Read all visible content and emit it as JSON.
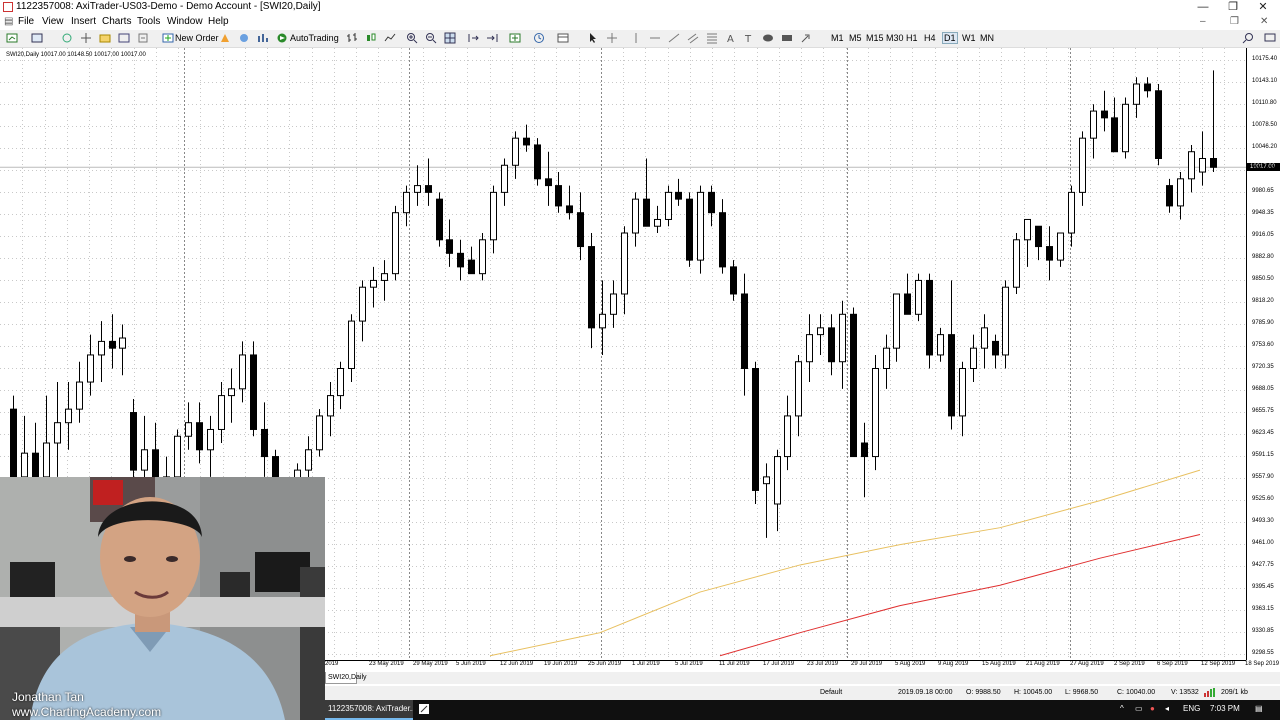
{
  "window": {
    "title": "1122357008: AxiTrader-US03-Demo - Demo Account - [SWI20,Daily]",
    "minimize": "—",
    "restore": "❐",
    "close": "✕"
  },
  "menu": {
    "items": [
      "File",
      "View",
      "Insert",
      "Charts",
      "Tools",
      "Window",
      "Help"
    ]
  },
  "toolbar": {
    "new_order_label": "New Order",
    "autotrading_label": "AutoTrading",
    "timeframes": [
      "M1",
      "M5",
      "M15",
      "M30",
      "H1",
      "H4",
      "D1",
      "W1",
      "MN"
    ],
    "active_timeframe": "D1"
  },
  "chart": {
    "symbol_info": "SWI20,Daily  10017.00 10148.50 10017.00 10017.00",
    "current_price": "10017.00",
    "price_scale": [
      "10175.40",
      "10143.10",
      "10110.80",
      "10078.50",
      "10046.20",
      "10013.90",
      "9980.65",
      "9948.35",
      "9916.05",
      "9882.80",
      "9850.50",
      "9818.20",
      "9785.90",
      "9753.60",
      "9720.35",
      "9688.05",
      "9655.75",
      "9623.45",
      "9591.15",
      "9557.90",
      "9525.60",
      "9493.30",
      "9461.00",
      "9427.75",
      "9395.45",
      "9363.15",
      "9330.85",
      "9298.55"
    ],
    "time_scale": [
      "2019",
      "23 May 2019",
      "29 May 2019",
      "5 Jun 2019",
      "12 Jun 2019",
      "19 Jun 2019",
      "25 Jun 2019",
      "1 Jul 2019",
      "5 Jul 2019",
      "11 Jul 2019",
      "17 Jul 2019",
      "23 Jul 2019",
      "29 Jul 2019",
      "5 Aug 2019",
      "9 Aug 2019",
      "15 Aug 2019",
      "21 Aug 2019",
      "27 Aug 2019",
      "2 Sep 2019",
      "6 Sep 2019",
      "12 Sep 2019",
      "18 Sep 2019"
    ],
    "tab_label": "SWI20,Daily",
    "bull_color": "#ffffff",
    "bear_color": "#000000",
    "ma_slow_color": "#e8c060",
    "ma_fast_color": "#e03030"
  },
  "chart_data": {
    "type": "candlestick",
    "title": "SWI20,Daily",
    "ylim": [
      9298.55,
      10175.4
    ],
    "candles": [
      {
        "o": 9660,
        "h": 9680,
        "l": 9520,
        "c": 9545
      },
      {
        "o": 9560,
        "h": 9650,
        "l": 9530,
        "c": 9595
      },
      {
        "o": 9595,
        "h": 9640,
        "l": 9520,
        "c": 9560
      },
      {
        "o": 9560,
        "h": 9680,
        "l": 9540,
        "c": 9610
      },
      {
        "o": 9610,
        "h": 9700,
        "l": 9560,
        "c": 9640
      },
      {
        "o": 9640,
        "h": 9700,
        "l": 9600,
        "c": 9660
      },
      {
        "o": 9660,
        "h": 9730,
        "l": 9640,
        "c": 9700
      },
      {
        "o": 9700,
        "h": 9770,
        "l": 9680,
        "c": 9740
      },
      {
        "o": 9740,
        "h": 9790,
        "l": 9700,
        "c": 9760
      },
      {
        "o": 9760,
        "h": 9800,
        "l": 9720,
        "c": 9750
      },
      {
        "o": 9750,
        "h": 9785,
        "l": 9710,
        "c": 9765
      },
      {
        "o": 9655,
        "h": 9675,
        "l": 9550,
        "c": 9570
      },
      {
        "o": 9570,
        "h": 9650,
        "l": 9530,
        "c": 9600
      },
      {
        "o": 9600,
        "h": 9640,
        "l": 9510,
        "c": 9530
      },
      {
        "o": 9530,
        "h": 9590,
        "l": 9500,
        "c": 9560
      },
      {
        "o": 9560,
        "h": 9630,
        "l": 9540,
        "c": 9620
      },
      {
        "o": 9620,
        "h": 9670,
        "l": 9600,
        "c": 9640
      },
      {
        "o": 9640,
        "h": 9670,
        "l": 9580,
        "c": 9600
      },
      {
        "o": 9600,
        "h": 9650,
        "l": 9560,
        "c": 9630
      },
      {
        "o": 9630,
        "h": 9700,
        "l": 9610,
        "c": 9680
      },
      {
        "o": 9680,
        "h": 9720,
        "l": 9640,
        "c": 9690
      },
      {
        "o": 9690,
        "h": 9760,
        "l": 9670,
        "c": 9740
      },
      {
        "o": 9740,
        "h": 9760,
        "l": 9620,
        "c": 9630
      },
      {
        "o": 9630,
        "h": 9670,
        "l": 9560,
        "c": 9590
      },
      {
        "o": 9590,
        "h": 9600,
        "l": 9460,
        "c": 9480
      },
      {
        "o": 9480,
        "h": 9530,
        "l": 9450,
        "c": 9510
      },
      {
        "o": 9510,
        "h": 9580,
        "l": 9470,
        "c": 9570
      },
      {
        "o": 9570,
        "h": 9620,
        "l": 9550,
        "c": 9600
      },
      {
        "o": 9600,
        "h": 9660,
        "l": 9590,
        "c": 9650
      },
      {
        "o": 9650,
        "h": 9700,
        "l": 9620,
        "c": 9680
      },
      {
        "o": 9680,
        "h": 9730,
        "l": 9660,
        "c": 9720
      },
      {
        "o": 9720,
        "h": 9800,
        "l": 9700,
        "c": 9790
      },
      {
        "o": 9790,
        "h": 9850,
        "l": 9760,
        "c": 9840
      },
      {
        "o": 9840,
        "h": 9870,
        "l": 9810,
        "c": 9850
      },
      {
        "o": 9850,
        "h": 9880,
        "l": 9820,
        "c": 9860
      },
      {
        "o": 9860,
        "h": 9960,
        "l": 9850,
        "c": 9950
      },
      {
        "o": 9950,
        "h": 9990,
        "l": 9930,
        "c": 9980
      },
      {
        "o": 9980,
        "h": 10020,
        "l": 9960,
        "c": 9990
      },
      {
        "o": 9990,
        "h": 10030,
        "l": 9960,
        "c": 9980
      },
      {
        "o": 9970,
        "h": 9980,
        "l": 9900,
        "c": 9910
      },
      {
        "o": 9910,
        "h": 9940,
        "l": 9870,
        "c": 9890
      },
      {
        "o": 9890,
        "h": 9910,
        "l": 9850,
        "c": 9870
      },
      {
        "o": 9880,
        "h": 9900,
        "l": 9860,
        "c": 9860
      },
      {
        "o": 9860,
        "h": 9920,
        "l": 9850,
        "c": 9910
      },
      {
        "o": 9910,
        "h": 9990,
        "l": 9890,
        "c": 9980
      },
      {
        "o": 9980,
        "h": 10030,
        "l": 9960,
        "c": 10020
      },
      {
        "o": 10020,
        "h": 10070,
        "l": 10000,
        "c": 10060
      },
      {
        "o": 10060,
        "h": 10080,
        "l": 10040,
        "c": 10050
      },
      {
        "o": 10050,
        "h": 10060,
        "l": 9990,
        "c": 10000
      },
      {
        "o": 10000,
        "h": 10040,
        "l": 9960,
        "c": 9990
      },
      {
        "o": 9990,
        "h": 10010,
        "l": 9950,
        "c": 9960
      },
      {
        "o": 9960,
        "h": 9990,
        "l": 9940,
        "c": 9950
      },
      {
        "o": 9950,
        "h": 9980,
        "l": 9880,
        "c": 9900
      },
      {
        "o": 9900,
        "h": 9920,
        "l": 9750,
        "c": 9780
      },
      {
        "o": 9780,
        "h": 9850,
        "l": 9740,
        "c": 9800
      },
      {
        "o": 9800,
        "h": 9850,
        "l": 9780,
        "c": 9830
      },
      {
        "o": 9830,
        "h": 9930,
        "l": 9800,
        "c": 9920
      },
      {
        "o": 9920,
        "h": 9980,
        "l": 9900,
        "c": 9970
      },
      {
        "o": 9970,
        "h": 10030,
        "l": 9930,
        "c": 9930
      },
      {
        "o": 9930,
        "h": 9960,
        "l": 9920,
        "c": 9940
      },
      {
        "o": 9940,
        "h": 9990,
        "l": 9930,
        "c": 9980
      },
      {
        "o": 9980,
        "h": 10000,
        "l": 9960,
        "c": 9970
      },
      {
        "o": 9970,
        "h": 9980,
        "l": 9870,
        "c": 9880
      },
      {
        "o": 9880,
        "h": 9990,
        "l": 9860,
        "c": 9980
      },
      {
        "o": 9980,
        "h": 9990,
        "l": 9930,
        "c": 9950
      },
      {
        "o": 9950,
        "h": 9970,
        "l": 9860,
        "c": 9870
      },
      {
        "o": 9870,
        "h": 9880,
        "l": 9820,
        "c": 9830
      },
      {
        "o": 9830,
        "h": 9860,
        "l": 9680,
        "c": 9720
      },
      {
        "o": 9720,
        "h": 9730,
        "l": 9520,
        "c": 9540
      },
      {
        "o": 9550,
        "h": 9580,
        "l": 9470,
        "c": 9560
      },
      {
        "o": 9520,
        "h": 9600,
        "l": 9480,
        "c": 9590
      },
      {
        "o": 9590,
        "h": 9680,
        "l": 9570,
        "c": 9650
      },
      {
        "o": 9650,
        "h": 9740,
        "l": 9620,
        "c": 9730
      },
      {
        "o": 9730,
        "h": 9800,
        "l": 9700,
        "c": 9770
      },
      {
        "o": 9770,
        "h": 9800,
        "l": 9740,
        "c": 9780
      },
      {
        "o": 9780,
        "h": 9800,
        "l": 9710,
        "c": 9730
      },
      {
        "o": 9730,
        "h": 9820,
        "l": 9690,
        "c": 9800
      },
      {
        "o": 9800,
        "h": 9810,
        "l": 9660,
        "c": 9590
      },
      {
        "o": 9610,
        "h": 9640,
        "l": 9530,
        "c": 9590
      },
      {
        "o": 9590,
        "h": 9740,
        "l": 9570,
        "c": 9720
      },
      {
        "o": 9720,
        "h": 9770,
        "l": 9690,
        "c": 9750
      },
      {
        "o": 9750,
        "h": 9830,
        "l": 9730,
        "c": 9830
      },
      {
        "o": 9830,
        "h": 9860,
        "l": 9800,
        "c": 9800
      },
      {
        "o": 9800,
        "h": 9860,
        "l": 9790,
        "c": 9850
      },
      {
        "o": 9850,
        "h": 9860,
        "l": 9720,
        "c": 9740
      },
      {
        "o": 9740,
        "h": 9780,
        "l": 9730,
        "c": 9770
      },
      {
        "o": 9770,
        "h": 9850,
        "l": 9630,
        "c": 9650
      },
      {
        "o": 9650,
        "h": 9730,
        "l": 9620,
        "c": 9720
      },
      {
        "o": 9720,
        "h": 9770,
        "l": 9700,
        "c": 9750
      },
      {
        "o": 9750,
        "h": 9800,
        "l": 9720,
        "c": 9780
      },
      {
        "o": 9760,
        "h": 9770,
        "l": 9720,
        "c": 9740
      },
      {
        "o": 9740,
        "h": 9850,
        "l": 9720,
        "c": 9840
      },
      {
        "o": 9840,
        "h": 9920,
        "l": 9830,
        "c": 9910
      },
      {
        "o": 9910,
        "h": 9940,
        "l": 9870,
        "c": 9940
      },
      {
        "o": 9930,
        "h": 9930,
        "l": 9880,
        "c": 9900
      },
      {
        "o": 9900,
        "h": 9930,
        "l": 9850,
        "c": 9880
      },
      {
        "o": 9880,
        "h": 9920,
        "l": 9870,
        "c": 9920
      },
      {
        "o": 9920,
        "h": 9990,
        "l": 9900,
        "c": 9980
      },
      {
        "o": 9980,
        "h": 10070,
        "l": 9960,
        "c": 10060
      },
      {
        "o": 10060,
        "h": 10110,
        "l": 10030,
        "c": 10100
      },
      {
        "o": 10100,
        "h": 10130,
        "l": 10070,
        "c": 10090
      },
      {
        "o": 10090,
        "h": 10120,
        "l": 10040,
        "c": 10040
      },
      {
        "o": 10040,
        "h": 10120,
        "l": 10030,
        "c": 10110
      },
      {
        "o": 10110,
        "h": 10150,
        "l": 10090,
        "c": 10140
      },
      {
        "o": 10140,
        "h": 10150,
        "l": 10120,
        "c": 10130
      },
      {
        "o": 10130,
        "h": 10140,
        "l": 10020,
        "c": 10030
      },
      {
        "o": 9990,
        "h": 10000,
        "l": 9950,
        "c": 9960
      },
      {
        "o": 9960,
        "h": 10010,
        "l": 9940,
        "c": 10000
      },
      {
        "o": 10000,
        "h": 10050,
        "l": 9980,
        "c": 10040
      },
      {
        "o": 10010,
        "h": 10070,
        "l": 9990,
        "c": 10030
      },
      {
        "o": 10030,
        "h": 10160,
        "l": 10010,
        "c": 10017
      }
    ],
    "ma_slow": [
      {
        "t": 0.49,
        "v": 9296
      },
      {
        "t": 0.6,
        "v": 9330
      },
      {
        "t": 0.7,
        "v": 9390
      },
      {
        "t": 0.8,
        "v": 9430
      },
      {
        "t": 0.9,
        "v": 9460
      },
      {
        "t": 1.0,
        "v": 9485
      },
      {
        "t": 1.1,
        "v": 9525
      },
      {
        "t": 1.2,
        "v": 9570
      }
    ],
    "ma_fast": [
      {
        "t": 0.72,
        "v": 9296
      },
      {
        "t": 0.8,
        "v": 9330
      },
      {
        "t": 0.9,
        "v": 9370
      },
      {
        "t": 1.0,
        "v": 9400
      },
      {
        "t": 1.1,
        "v": 9440
      },
      {
        "t": 1.2,
        "v": 9475
      }
    ]
  },
  "status": {
    "profile": "Default",
    "datetime": "2019.09.18 00:00",
    "open": "O: 9988.50",
    "high": "H: 10045.00",
    "low": "L: 9968.50",
    "close": "C: 10040.00",
    "volume": "V: 13532",
    "traffic": "209/1 kb"
  },
  "taskbar": {
    "task_label": "1122357008: AxiTrader...",
    "language": "ENG",
    "time": "7:03 PM"
  },
  "webcam": {
    "name": "Jonathan Tan",
    "website": "www.ChartingAcademy.com"
  }
}
